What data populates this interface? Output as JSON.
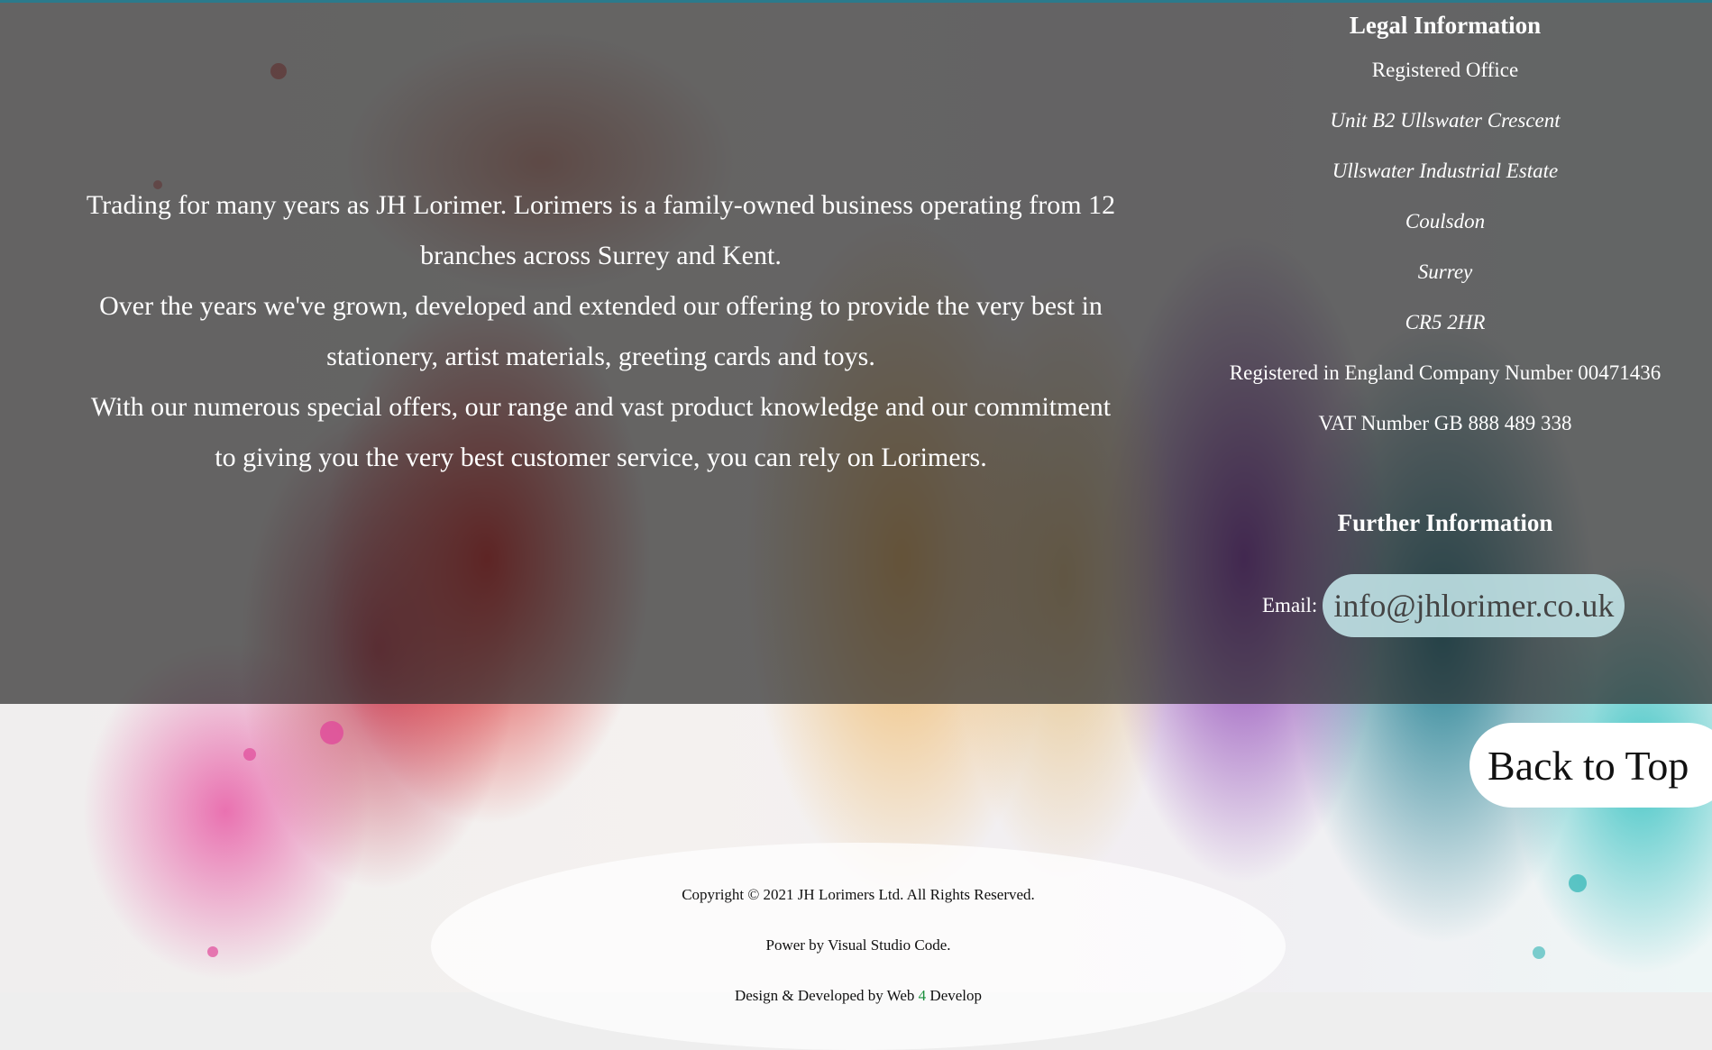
{
  "about": {
    "paragraph1": "Trading for many years as JH Lorimer. Lorimers is a family-owned business operating from 12 branches across Surrey and Kent.",
    "paragraph2": "Over the years we've grown, developed and extended our offering to provide the very best in stationery, artist materials, greeting cards and toys.",
    "paragraph3": "With our numerous special offers, our range and vast product knowledge and our commitment to giving you the very best customer service, you can rely on Lorimers."
  },
  "legal": {
    "heading": "Legal Information",
    "registered_office": "Registered Office",
    "address": [
      "Unit B2 Ullswater Crescent",
      "Ullswater Industrial Estate",
      "Coulsdon",
      "Surrey",
      "CR5 2HR"
    ],
    "company_number": "Registered in England Company Number 00471436",
    "vat_number": "VAT Number GB 888 489 338"
  },
  "further": {
    "heading": "Further Information",
    "email_label": "Email:",
    "email": "info@jhlorimer.co.uk"
  },
  "back_to_top": "Back to Top",
  "footer": {
    "copyright": "Copyright © 2021 JH Lorimers Ltd. All Rights Reserved.",
    "powered": "Power by Visual Studio Code.",
    "credit_prefix": "Design & Developed by Web",
    "credit_accent": "4",
    "credit_suffix": " Develop"
  },
  "colors": {
    "topline": "#2b7a8c",
    "overlay": "rgba(40,40,40,0.7)",
    "email_pill": "#c8ebee",
    "credit_accent": "#1a8f3c"
  }
}
